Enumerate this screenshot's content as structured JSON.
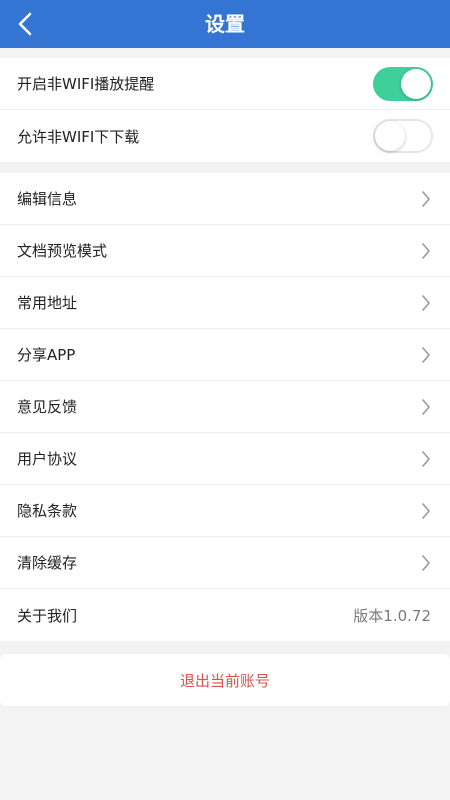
{
  "header": {
    "title": "设置",
    "back_icon": "chevron-left-icon"
  },
  "toggles": [
    {
      "label": "开启非WIFI播放提醒",
      "enabled": true
    },
    {
      "label": "允许非WIFI下下载",
      "enabled": false
    }
  ],
  "menu": [
    {
      "label": "编辑信息"
    },
    {
      "label": "文档预览模式"
    },
    {
      "label": "常用地址"
    },
    {
      "label": "分享APP"
    },
    {
      "label": "意见反馈"
    },
    {
      "label": "用户协议"
    },
    {
      "label": "隐私条款"
    },
    {
      "label": "清除缓存"
    }
  ],
  "about": {
    "label": "关于我们",
    "version": "版本1.0.72"
  },
  "logout": {
    "label": "退出当前账号"
  },
  "colors": {
    "header_bg": "#3475d4",
    "toggle_on": "#3fcf9a",
    "logout_text": "#d9534f"
  }
}
